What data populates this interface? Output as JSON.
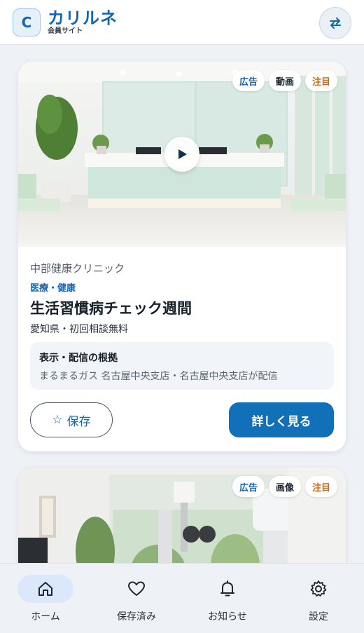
{
  "header": {
    "logo_letter": "C",
    "brand_name": "カリルネ",
    "brand_sub": "会員サイト",
    "switch_icon": "swap-arrows-icon"
  },
  "cards": [
    {
      "badges": [
        "広告",
        "動画",
        "注目"
      ],
      "advertiser": "中部健康クリニック",
      "category": "医療・健康",
      "title": "生活習慣病チェック週間",
      "subtitle": "愛知県・初回相談無料",
      "reason_title": "表示・配信の根拠",
      "reason_text": "まるまるガス 名古屋中央支店・名古屋中央支店が配信",
      "save_label": "保存",
      "save_icon": "☆",
      "detail_label": "詳しく見る"
    },
    {
      "badges": [
        "広告",
        "画像",
        "注目"
      ]
    }
  ],
  "nav": [
    {
      "label": "ホーム",
      "icon": "home-icon"
    },
    {
      "label": "保存済み",
      "icon": "heart-icon"
    },
    {
      "label": "お知らせ",
      "icon": "bell-icon"
    },
    {
      "label": "設定",
      "icon": "gear-icon"
    }
  ],
  "colors": {
    "primary": "#1466b3",
    "button": "#1270b8",
    "accent_badge": "#c76a14",
    "nav_active_bg": "#dbe7fb"
  }
}
